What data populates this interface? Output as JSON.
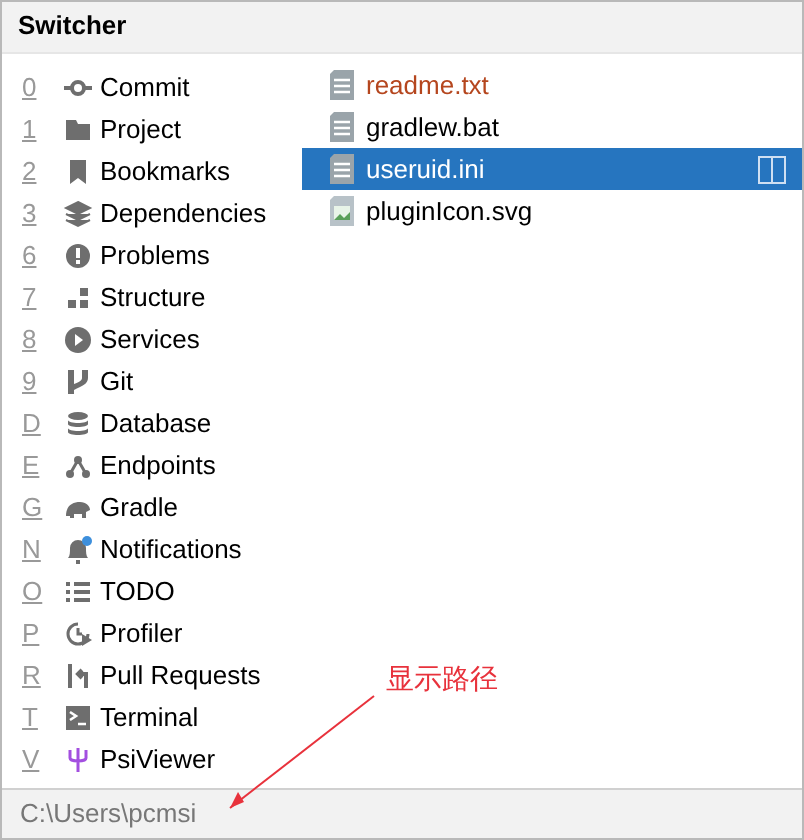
{
  "window": {
    "title": "Switcher"
  },
  "tools": [
    {
      "key": "0",
      "label": "Commit"
    },
    {
      "key": "1",
      "label": "Project"
    },
    {
      "key": "2",
      "label": "Bookmarks"
    },
    {
      "key": "3",
      "label": "Dependencies"
    },
    {
      "key": "6",
      "label": "Problems"
    },
    {
      "key": "7",
      "label": "Structure"
    },
    {
      "key": "8",
      "label": "Services"
    },
    {
      "key": "9",
      "label": "Git"
    },
    {
      "key": "D",
      "label": "Database"
    },
    {
      "key": "E",
      "label": "Endpoints"
    },
    {
      "key": "G",
      "label": "Gradle"
    },
    {
      "key": "N",
      "label": "Notifications"
    },
    {
      "key": "O",
      "label": "TODO"
    },
    {
      "key": "P",
      "label": "Profiler"
    },
    {
      "key": "R",
      "label": "Pull Requests"
    },
    {
      "key": "T",
      "label": "Terminal"
    },
    {
      "key": "V",
      "label": "PsiViewer"
    }
  ],
  "files": [
    {
      "name": "readme.txt",
      "kind": "text",
      "modified": true,
      "selected": false
    },
    {
      "name": "gradlew.bat",
      "kind": "text",
      "modified": false,
      "selected": false
    },
    {
      "name": "useruid.ini",
      "kind": "text",
      "modified": false,
      "selected": true
    },
    {
      "name": "pluginIcon.svg",
      "kind": "image",
      "modified": false,
      "selected": false
    }
  ],
  "annotation": {
    "text": "显示路径"
  },
  "status_bar": {
    "path": "C:\\Users\\pcmsi"
  }
}
